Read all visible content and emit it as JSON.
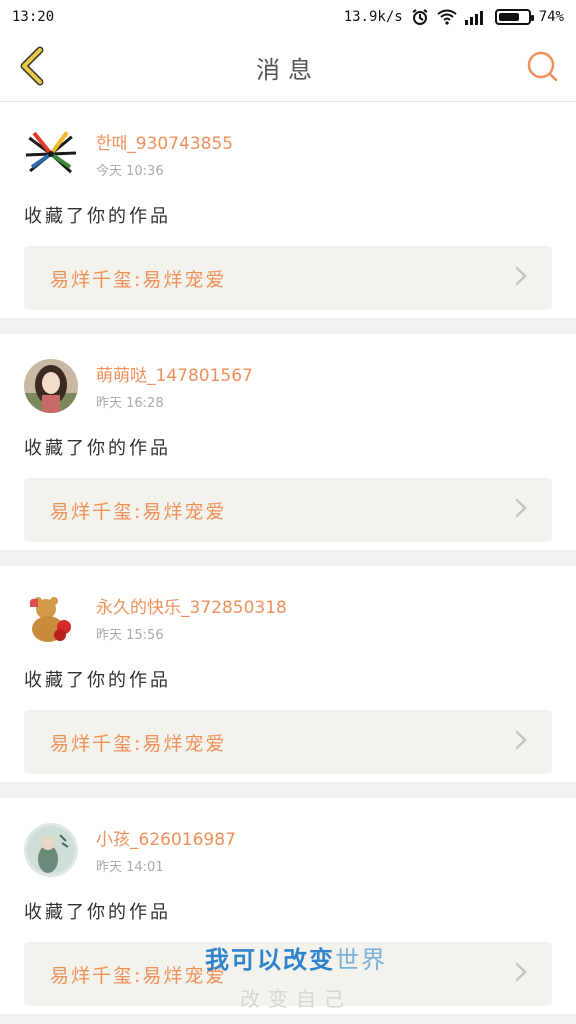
{
  "status_bar": {
    "time": "13:20",
    "network_speed": "13.9k/s",
    "battery": "74%",
    "battery_level": 0.74
  },
  "app_bar": {
    "title": "消息",
    "icons": {
      "back": "chevron-left-icon",
      "search": "search-icon"
    },
    "accent_color": "#e8c84a",
    "search_color": "#f0905a"
  },
  "messages": [
    {
      "username": "한때_930743855",
      "time": "今天 10:36",
      "action": "收藏了你的作品",
      "work_title": "易烊千玺:易烊宠爱"
    },
    {
      "username": "萌萌哒_147801567",
      "time": "昨天 16:28",
      "action": "收藏了你的作品",
      "work_title": "易烊千玺:易烊宠爱"
    },
    {
      "username": "永久的快乐_372850318",
      "time": "昨天 15:56",
      "action": "收藏了你的作品",
      "work_title": "易烊千玺:易烊宠爱"
    },
    {
      "username": "小孩_626016987",
      "time": "昨天 14:01",
      "action": "收藏了你的作品",
      "work_title": "易烊千玺:易烊宠爱"
    }
  ],
  "watermark": {
    "line1_accent": "我可以改变",
    "line1_rest": "世界",
    "line2": "改变自己"
  }
}
